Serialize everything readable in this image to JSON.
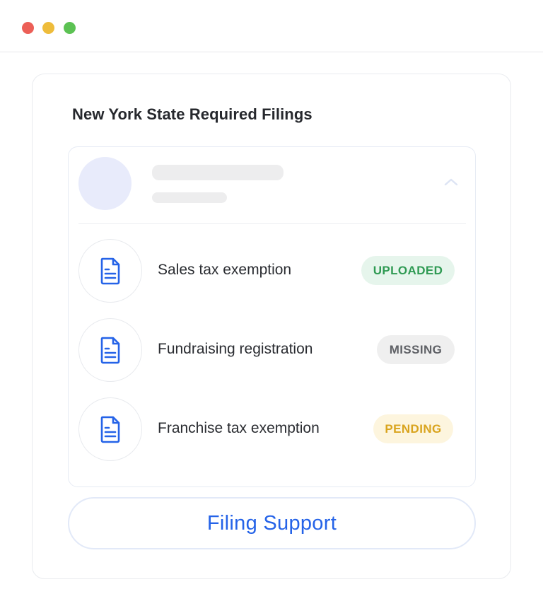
{
  "window": {
    "controls": [
      "close",
      "minimize",
      "maximize"
    ]
  },
  "card": {
    "title": "New York State Required Filings"
  },
  "filings": [
    {
      "label": "Sales tax exemption",
      "status": "UPLOADED",
      "icon": "document-icon"
    },
    {
      "label": "Fundraising registration",
      "status": "MISSING",
      "icon": "document-icon"
    },
    {
      "label": "Franchise tax exemption",
      "status": "PENDING",
      "icon": "document-icon"
    }
  ],
  "status_colors": {
    "UPLOADED": "#2f9a53",
    "MISSING": "#5f6166",
    "PENDING": "#d9a41e"
  },
  "accent_color": "#2563e8",
  "actions": {
    "support_label": "Filing Support"
  },
  "icons": {
    "collapse": "chevron-up-icon",
    "document": "document-icon"
  }
}
